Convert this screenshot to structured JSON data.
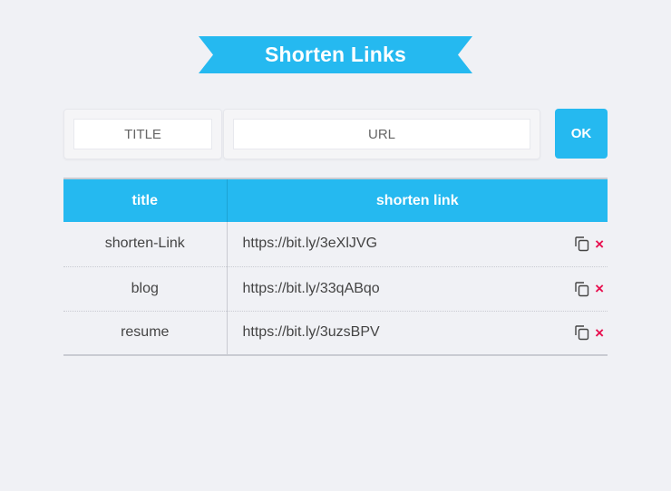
{
  "header": {
    "title": "Shorten Links"
  },
  "form": {
    "title_placeholder": "TITLE",
    "url_placeholder": "URL",
    "title_value": "",
    "url_value": "",
    "submit_label": "OK"
  },
  "table": {
    "columns": [
      "title",
      "shorten link"
    ],
    "rows": [
      {
        "title": "shorten-Link",
        "link": "https://bit.ly/3eXlJVG"
      },
      {
        "title": "blog",
        "link": "https://bit.ly/33qABqo"
      },
      {
        "title": "resume",
        "link": "https://bit.ly/3uzsBPV"
      }
    ],
    "delete_symbol": "×"
  },
  "icons": {
    "copy": "copy-icon",
    "delete": "close-icon"
  },
  "colors": {
    "accent": "#25b9f0",
    "delete": "#e8104f",
    "background": "#f0f1f5"
  }
}
